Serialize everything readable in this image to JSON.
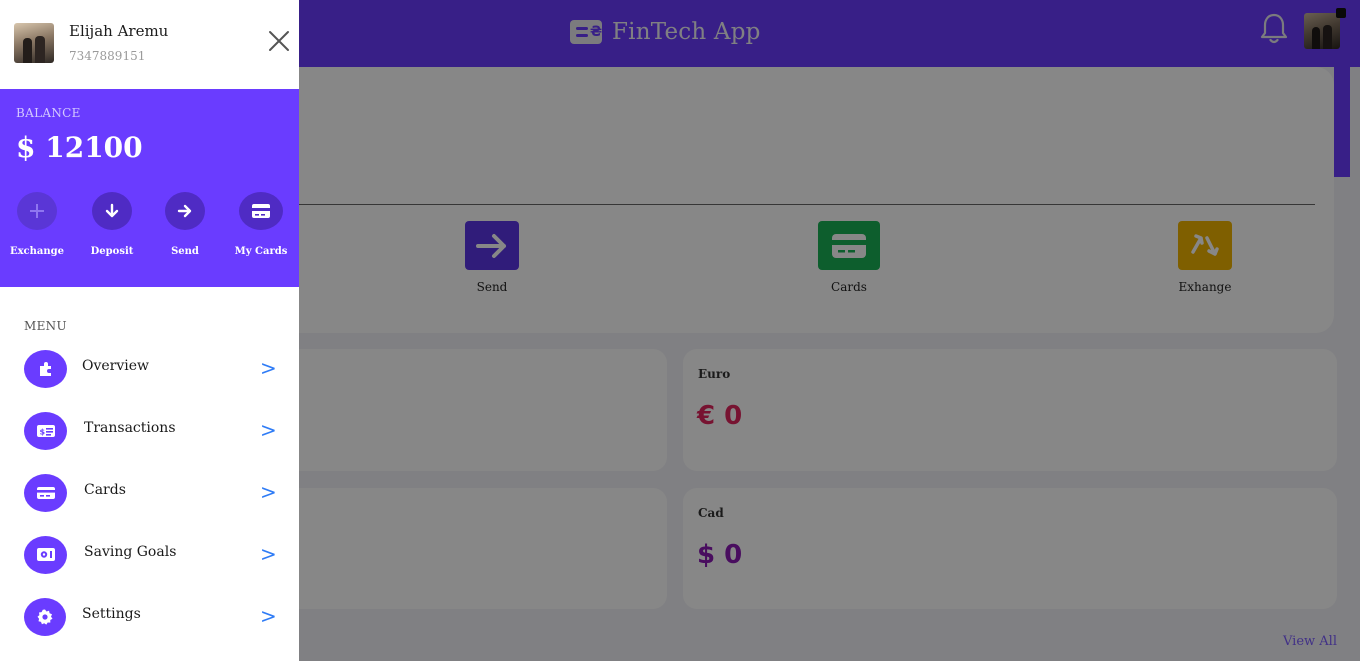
{
  "app": {
    "title": "FinTech App",
    "actions": [
      {
        "label": "Send",
        "color": "#5b35e6"
      },
      {
        "label": "Cards",
        "color": "#19b256"
      },
      {
        "label": "Exhange",
        "color": "#f0b400"
      }
    ],
    "currencies": [
      {
        "name": "Euro",
        "symbol": "€",
        "amount": "0",
        "display": "€ 0",
        "color": "#e0245e"
      },
      {
        "name": "Cad",
        "symbol": "$",
        "amount": "0",
        "display": "$ 0",
        "color": "#8a1ab3"
      }
    ],
    "view_all_label": "View All"
  },
  "drawer": {
    "user": {
      "name": "Elijah Aremu",
      "phone": "7347889151"
    },
    "balance": {
      "label": "BALANCE",
      "amount": "$ 12100"
    },
    "quick_actions": [
      {
        "label": "Exchange",
        "icon": "plus-icon"
      },
      {
        "label": "Deposit",
        "icon": "arrow-down-icon"
      },
      {
        "label": "Send",
        "icon": "arrow-right-icon"
      },
      {
        "label": "My Cards",
        "icon": "card-icon"
      }
    ],
    "menu_title": "MENU",
    "menu": [
      {
        "label": "Overview",
        "icon": "puzzle-icon"
      },
      {
        "label": "Transactions",
        "icon": "receipt-icon"
      },
      {
        "label": "Cards",
        "icon": "card-icon"
      },
      {
        "label": "Saving Goals",
        "icon": "safe-icon"
      },
      {
        "label": "Settings",
        "icon": "gear-icon"
      }
    ],
    "chevron": ">"
  },
  "colors": {
    "accent": "#6a3cff",
    "link": "#2f7cf6"
  }
}
